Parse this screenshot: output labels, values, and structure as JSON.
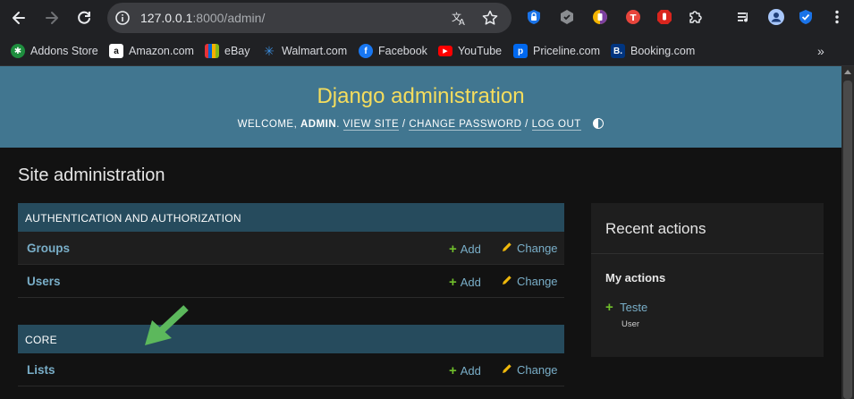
{
  "browser": {
    "url_host": "127.0.0.1",
    "url_path": ":8000/admin/",
    "bookmarks": [
      {
        "label": "Addons Store",
        "icon": "addons-store-icon",
        "color": "#1e8e3e"
      },
      {
        "label": "Amazon.com",
        "icon": "amazon-icon",
        "color": "#ffffff"
      },
      {
        "label": "eBay",
        "icon": "ebay-icon",
        "color": "#e53238"
      },
      {
        "label": "Walmart.com",
        "icon": "walmart-icon",
        "color": "#0071ce"
      },
      {
        "label": "Facebook",
        "icon": "facebook-icon",
        "color": "#1877f2"
      },
      {
        "label": "YouTube",
        "icon": "youtube-icon",
        "color": "#ff0000"
      },
      {
        "label": "Priceline.com",
        "icon": "priceline-icon",
        "color": "#0068ef"
      },
      {
        "label": "Booking.com",
        "icon": "booking-icon",
        "color": "#003580"
      }
    ],
    "bookmarks_more": "»"
  },
  "admin": {
    "branding": "Django administration",
    "welcome_prefix": "Welcome,",
    "username": "admin",
    "view_site": "View site",
    "change_password": "Change password",
    "log_out": "Log out",
    "page_title": "Site administration",
    "modules": [
      {
        "caption": "Authentication and Authorization",
        "models": [
          {
            "name": "Groups",
            "add": "Add",
            "change": "Change"
          },
          {
            "name": "Users",
            "add": "Add",
            "change": "Change"
          }
        ]
      },
      {
        "caption": "Core",
        "models": [
          {
            "name": "Lists",
            "add": "Add",
            "change": "Change"
          }
        ]
      }
    ],
    "recent": {
      "title": "Recent actions",
      "my_actions": "My actions",
      "items": [
        {
          "name": "Teste",
          "type": "User"
        }
      ]
    }
  },
  "colors": {
    "header": "#417690",
    "branding": "#f5dd5d",
    "module_caption": "#264b5d",
    "link": "#79aec8",
    "add_icon": "#70bf2b",
    "change_icon": "#efb80b",
    "annotation_arrow": "#5cb85c"
  }
}
